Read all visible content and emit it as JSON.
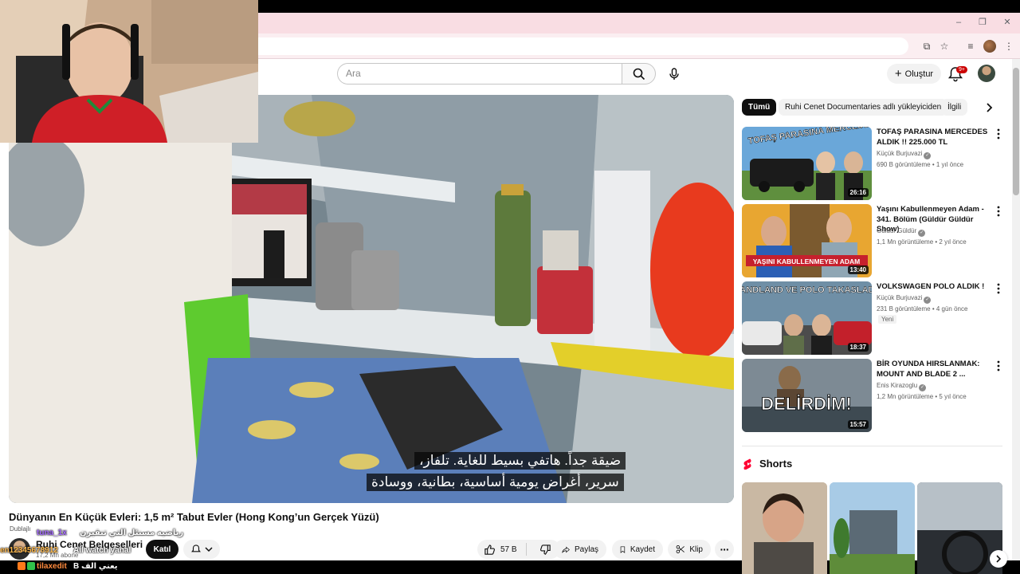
{
  "browser": {
    "window_controls": [
      "–",
      "❐",
      "✕"
    ]
  },
  "header": {
    "search_placeholder": "Ara",
    "create_label": "Oluştur",
    "notification_count": "9+"
  },
  "player": {
    "captions": [
      "ضيقة جداً. هاتفي بسيط للغاية. تلفاز،",
      "سرير، أغراض يومية أساسية، بطانية، ووسادة"
    ]
  },
  "video": {
    "title": "Dünyanın En Küçük Evleri: 1,5 m² Tabut Evler (Hong Kong’un Gerçek Yüzü)",
    "dubbed_label": "Dublajlı",
    "channel_name": "Ruhi Cenet Belgeselleri",
    "subscriber_count": "17,2 Mn abone",
    "join_label": "Katıl",
    "likes": "57 B",
    "share_label": "Paylaş",
    "save_label": "Kaydet",
    "clip_label": "Klip"
  },
  "chat": {
    "line1_user": "tuna_1x",
    "line1_msg": "رياضيه مسنئل التي تنقيرن",
    "line2_user": "en12345678912",
    "line2_msg": "All watch yanal",
    "line3_user": "tilaxedit",
    "line3_msg": "B يعني الف"
  },
  "sidebar": {
    "chips": [
      "Tümü",
      "Ruhi Cenet Documentaries adlı yükleyiciden",
      "İlgili"
    ],
    "recommendations": [
      {
        "title": "TOFAŞ PARASINA MERCEDES ALDIK !! 225.000 TL",
        "channel": "Küçük Burjuvazi",
        "views": "690 B görüntüleme",
        "age": "1 yıl önce",
        "duration": "26:16",
        "thumb_text": "TOFAŞ PARASINA MERCEDES ALDIK",
        "badge": ""
      },
      {
        "title": "Yaşını Kabullenmeyen Adam - 341. Bölüm (Güldür Güldür Show)",
        "channel": "Güldür Güldür",
        "views": "1,1 Mn görüntüleme",
        "age": "2 yıl önce",
        "duration": "13:40",
        "thumb_text": "YAŞINI KABULLENMEYEN ADAM",
        "badge": ""
      },
      {
        "title": "VOLKSWAGEN POLO ALDIK !",
        "channel": "Küçük Burjuvazi",
        "views": "231 B görüntüleme",
        "age": "4 gün önce",
        "duration": "18:37",
        "thumb_text": "GRANDLAND VE POLO TAKASLADIK!",
        "badge": "Yeni"
      },
      {
        "title": "BİR OYUNDA HIRSLANMAK: MOUNT AND BLADE 2 ...",
        "channel": "Enis Kirazoglu",
        "views": "1,2 Mn görüntüleme",
        "age": "5 yıl önce",
        "duration": "15:57",
        "thumb_text": "DELİRDİM!",
        "badge": ""
      }
    ],
    "shorts_title": "Shorts"
  },
  "colors": {
    "accent": "#ff0000",
    "tab_strip": "#f9dde3"
  }
}
